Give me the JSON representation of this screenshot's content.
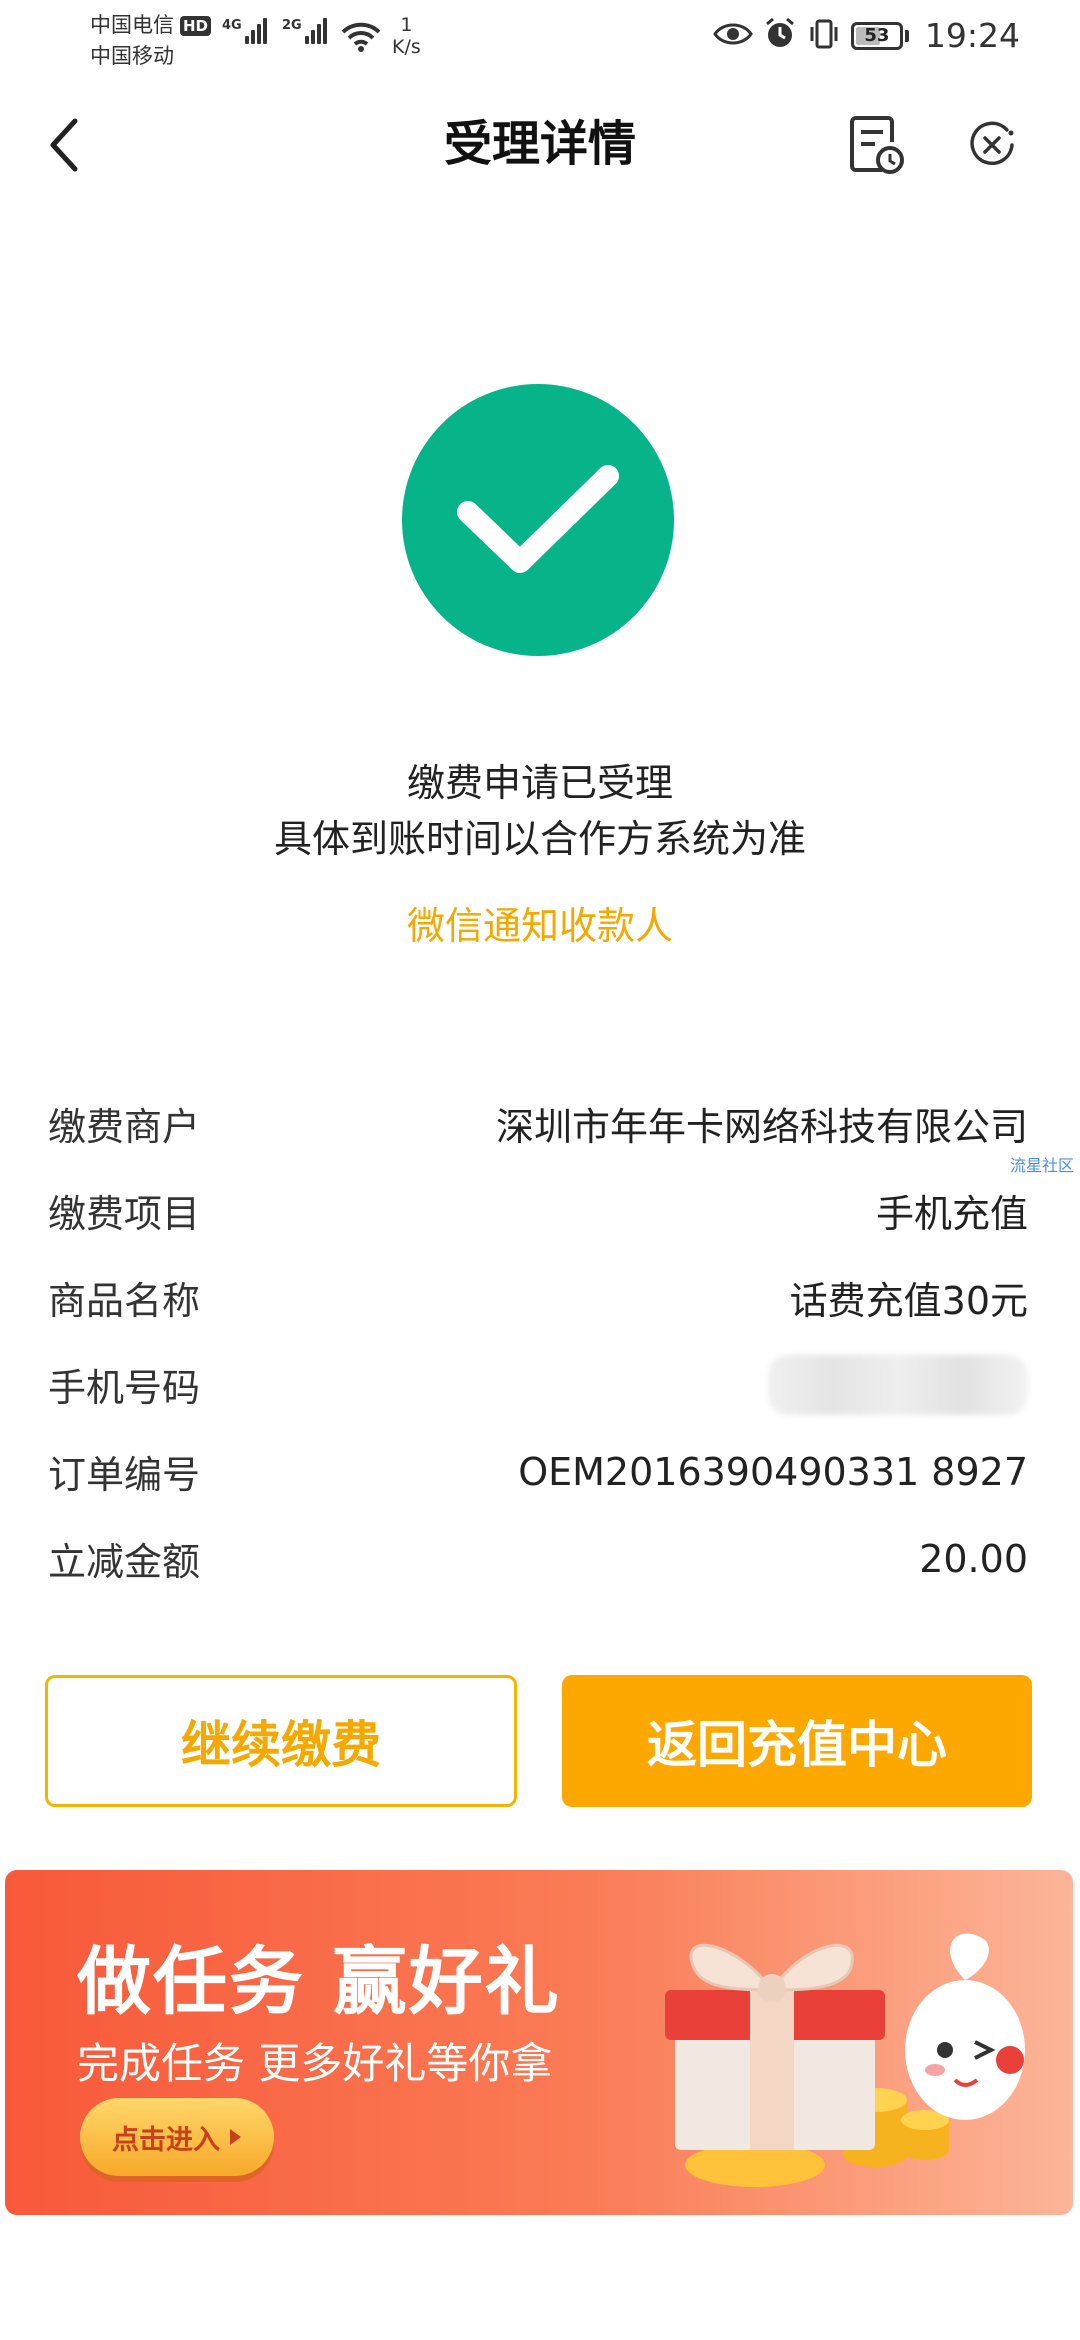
{
  "status_bar": {
    "carrier1": "中国电信",
    "hd_badge": "HD",
    "carrier2": "中国移动",
    "signal1_net": "4G",
    "signal2_net": "2G",
    "speed_value": "1",
    "speed_unit": "K/s",
    "battery_percent": "53",
    "time": "19:24"
  },
  "header": {
    "title": "受理详情"
  },
  "result": {
    "line1": "缴费申请已受理",
    "line2": "具体到账时间以合作方系统为准",
    "notify_link": "微信通知收款人",
    "success_color": "#07b48a"
  },
  "details": {
    "watermark": "流星社区",
    "rows": [
      {
        "label": "缴费商户",
        "value": "深圳市年年卡网络科技有限公司"
      },
      {
        "label": "缴费项目",
        "value": "手机充值"
      },
      {
        "label": "商品名称",
        "value": "话费充值30元"
      },
      {
        "label": "手机号码",
        "value": ""
      },
      {
        "label": "订单编号",
        "value": "OEM2016390490331 8927"
      },
      {
        "label": "立减金额",
        "value": "20.00"
      }
    ]
  },
  "buttons": {
    "continue_label": "继续缴费",
    "return_label": "返回充值中心",
    "accent_color": "#fca800"
  },
  "banner": {
    "title": "做任务 赢好礼",
    "subtitle": "完成任务 更多好礼等你拿",
    "cta_label": "点击进入"
  }
}
